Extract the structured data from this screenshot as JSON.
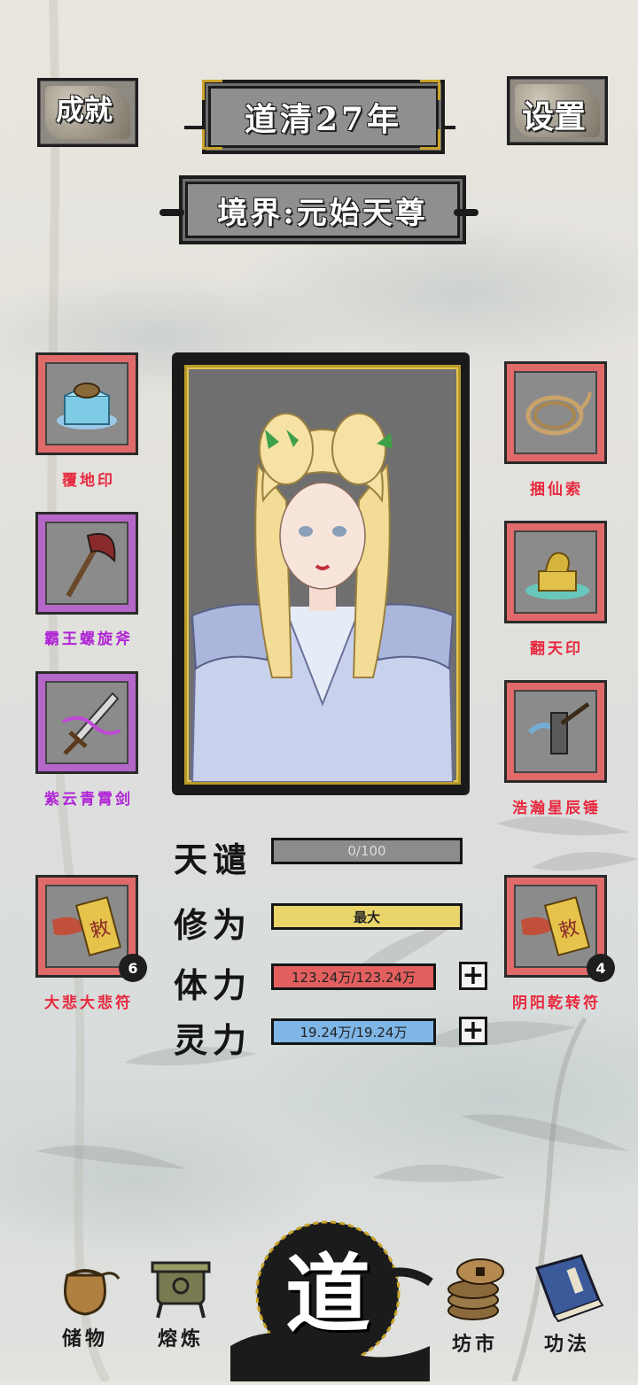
{
  "header": {
    "achievements_label": "成就",
    "year_title": "道清27年",
    "settings_label": "设置",
    "realm_text": "境界:元始天尊"
  },
  "left_slots": [
    {
      "label": "覆地印",
      "rarity": "red",
      "icon": "seal-treasure-icon"
    },
    {
      "label": "霸王螺旋斧",
      "rarity": "purple",
      "icon": "axe-icon"
    },
    {
      "label": "紫云青霄剑",
      "rarity": "purple",
      "icon": "sword-icon"
    },
    {
      "label": "大悲大悲符",
      "rarity": "red",
      "icon": "talisman-scroll-icon",
      "count": "6"
    }
  ],
  "right_slots": [
    {
      "label": "捆仙索",
      "rarity": "red",
      "icon": "rope-icon"
    },
    {
      "label": "翻天印",
      "rarity": "red",
      "icon": "dragon-seal-icon"
    },
    {
      "label": "浩瀚星辰锤",
      "rarity": "red",
      "icon": "hammer-icon"
    },
    {
      "label": "阴阳乾转符",
      "rarity": "red",
      "icon": "talisman-scroll-icon",
      "count": "4"
    }
  ],
  "stats": {
    "tribulation": {
      "label": "天谴",
      "value": "0/100",
      "fill": 0
    },
    "cultivation": {
      "label": "修为",
      "value": "最大",
      "fill": 1
    },
    "stamina": {
      "label": "体力",
      "value": "123.24万/123.24万",
      "fill": 1
    },
    "spirit": {
      "label": "灵力",
      "value": "19.24万/19.24万",
      "fill": 1
    }
  },
  "plus_symbol": "+",
  "nav": {
    "storage": "储物",
    "smelting": "熔炼",
    "center": "道",
    "market": "坊市",
    "techniques": "功法"
  },
  "colors": {
    "slot_red": "#e06a6a",
    "slot_purple": "#b567c9",
    "label_red": "#e8283e",
    "label_purple": "#b023d6",
    "bar_gray": "#8c8c8c",
    "bar_yellow": "#ead56a",
    "bar_red": "#e35f5f",
    "bar_blue": "#7fb6e8"
  }
}
